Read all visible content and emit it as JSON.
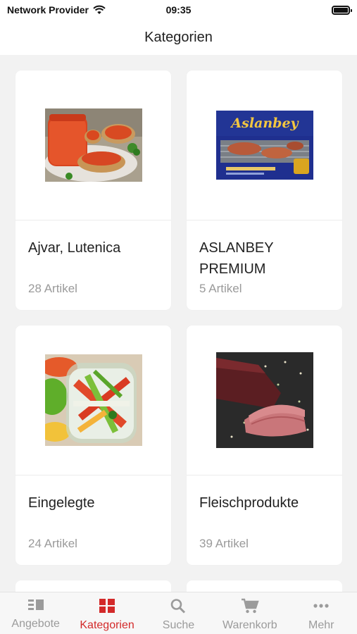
{
  "status_bar": {
    "carrier": "Network Provider",
    "time": "09:35"
  },
  "header": {
    "title": "Kategorien"
  },
  "categories": [
    {
      "title": "Ajvar, Lutenica",
      "count": "28 Artikel",
      "image_icon": "ajvar-bread-photo"
    },
    {
      "title": "ASLANBEY PREMIUM",
      "count": "5 Artikel",
      "image_icon": "aslanbey-package-photo",
      "image_text": "Aslanbey"
    },
    {
      "title": "Eingelegte",
      "count": "24 Artikel",
      "image_icon": "pickled-vegetables-jar-photo"
    },
    {
      "title": "Fleischprodukte",
      "count": "39 Artikel",
      "image_icon": "dried-meat-photo"
    }
  ],
  "tabs": [
    {
      "label": "Angebote",
      "icon": "list-icon",
      "active": false
    },
    {
      "label": "Kategorien",
      "icon": "grid-icon",
      "active": true
    },
    {
      "label": "Suche",
      "icon": "search-icon",
      "active": false
    },
    {
      "label": "Warenkorb",
      "icon": "cart-icon",
      "active": false
    },
    {
      "label": "Mehr",
      "icon": "more-dots-icon",
      "active": false
    }
  ],
  "colors": {
    "accent": "#d32a2a",
    "inactive": "#9b9b9b",
    "background": "#f2f2f2"
  }
}
